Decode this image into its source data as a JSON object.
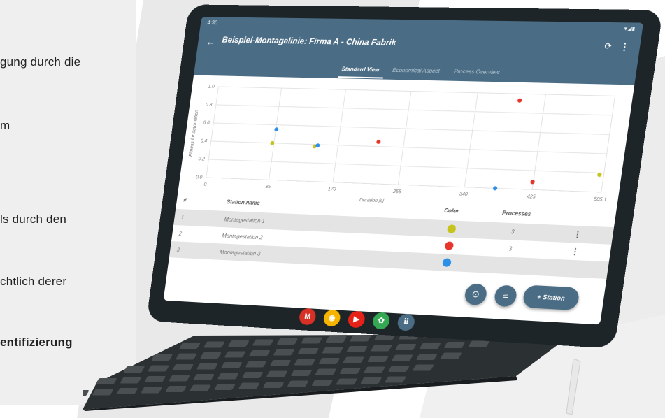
{
  "left_panel": {
    "lines": [
      "gung durch die",
      "m",
      "ls durch den",
      "chtlich derer",
      "entifizierung"
    ]
  },
  "status_bar": {
    "time": "4:30",
    "icons": "▾◢▮"
  },
  "app": {
    "title": "Beispiel-Montagelinie: Firma A - China Fabrik",
    "tabs": [
      "Standard View",
      "Economical Aspect",
      "Process Overview"
    ],
    "active_tab": 0
  },
  "chart_data": {
    "type": "scatter",
    "xlabel": "Duration [s]",
    "ylabel": "Fitness for automation",
    "x_ticks": [
      "0",
      "85",
      "170",
      "255",
      "340",
      "425",
      "505.1"
    ],
    "y_ticks": [
      "0.0",
      "0.2",
      "0.4",
      "0.6",
      "0.8",
      "1.0"
    ],
    "xlim": [
      0,
      505.1
    ],
    "ylim": [
      0,
      1.0
    ],
    "series": [
      {
        "color": "#c6c41c",
        "points": [
          [
            82,
            0.4
          ],
          [
            138,
            0.38
          ],
          [
            500,
            0.18
          ]
        ]
      },
      {
        "color": "#e8352c",
        "points": [
          [
            220,
            0.45
          ],
          [
            390,
            0.93
          ],
          [
            420,
            0.08
          ]
        ]
      },
      {
        "color": "#2e8fe6",
        "points": [
          [
            85,
            0.55
          ],
          [
            142,
            0.39
          ],
          [
            375,
            0.0
          ]
        ]
      }
    ]
  },
  "table": {
    "headers": {
      "num": "#",
      "name": "Station name",
      "color": "Color",
      "processes": "Processes"
    },
    "rows": [
      {
        "num": "1",
        "name": "Montagestation 1",
        "color": "#c6c41c",
        "processes": "3",
        "menu": "⋮"
      },
      {
        "num": "2",
        "name": "Montagestation 2",
        "color": "#e8352c",
        "processes": "3",
        "menu": "⋮"
      },
      {
        "num": "3",
        "name": "Montagestation 3",
        "color": "#2e8fe6",
        "processes": "",
        "menu": ""
      }
    ]
  },
  "fab": {
    "camera_icon": "camera-icon",
    "list_icon": "list-icon",
    "add_label": "+ Station"
  },
  "dock": {
    "apps": [
      {
        "name": "gmail-icon",
        "glyph": "M",
        "color": "#d93025"
      },
      {
        "name": "chrome-icon",
        "glyph": "◉",
        "color": "#f4b400"
      },
      {
        "name": "youtube-icon",
        "glyph": "▶",
        "color": "#e62117"
      },
      {
        "name": "photos-icon",
        "glyph": "✿",
        "color": "#34a853"
      },
      {
        "name": "app-drawer-icon",
        "glyph": "⠿",
        "color": "#4a6c84"
      }
    ]
  }
}
